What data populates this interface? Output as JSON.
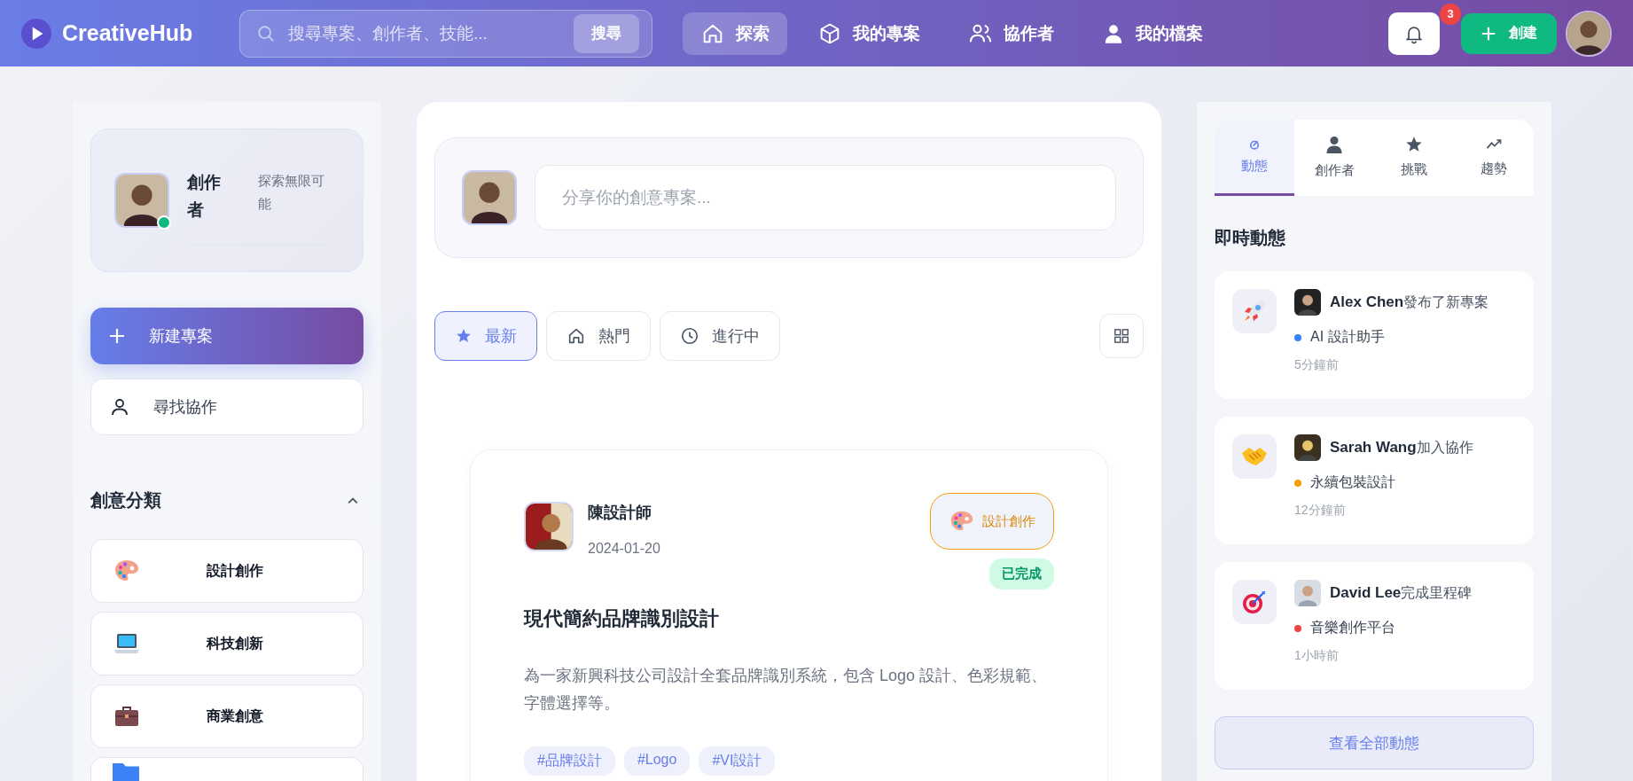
{
  "header": {
    "logo_text": "CreativeHub",
    "search": {
      "placeholder": "搜尋專案、創作者、技能...",
      "button": "搜尋"
    },
    "nav": [
      {
        "label": "探索",
        "kind": "home",
        "selected": true
      },
      {
        "label": "我的專案",
        "kind": "projects",
        "selected": false
      },
      {
        "label": "協作者",
        "kind": "collaborators",
        "selected": false
      },
      {
        "label": "我的檔案",
        "kind": "profile",
        "selected": false
      }
    ],
    "notifications": {
      "count": "3"
    },
    "create_button": "創建"
  },
  "sidebar": {
    "profile": {
      "name": "創作者",
      "tagline": "探索無限可能",
      "online": true
    },
    "actions": [
      {
        "label": "新建專案",
        "kind": "primary"
      },
      {
        "label": "尋找協作",
        "kind": "secondary"
      }
    ],
    "categories": {
      "title": "創意分類",
      "expanded": true,
      "items": [
        {
          "kind": "design",
          "label": "設計創作"
        },
        {
          "kind": "tech",
          "label": "科技創新"
        },
        {
          "kind": "business",
          "label": "商業創意"
        },
        {
          "kind": "other"
        }
      ]
    }
  },
  "feed": {
    "composer": {
      "placeholder": "分享你的創意專案..."
    },
    "filters": [
      {
        "label": "最新",
        "kind": "latest",
        "selected": true
      },
      {
        "label": "熱門",
        "kind": "popular",
        "selected": false
      },
      {
        "label": "進行中",
        "kind": "ongoing",
        "selected": false
      }
    ],
    "posts": [
      {
        "author": "陳設計師",
        "date": "2024-01-20",
        "category": {
          "kind": "design",
          "label": "設計創作"
        },
        "status": "已完成",
        "title": "現代簡約品牌識別設計",
        "description": "為一家新興科技公司設計全套品牌識別系統，包含 Logo 設計、色彩規範、字體選擇等。",
        "tags": [
          "#品牌設計",
          "#Logo",
          "#VI設計"
        ]
      }
    ]
  },
  "activity_panel": {
    "tabs": [
      {
        "label": "動態",
        "kind": "activity",
        "selected": true
      },
      {
        "label": "創作者",
        "kind": "creators",
        "selected": false
      },
      {
        "label": "挑戰",
        "kind": "challenges",
        "selected": false
      },
      {
        "label": "趨勢",
        "kind": "trends",
        "selected": false
      }
    ],
    "title": "即時動態",
    "activities": [
      {
        "kind": "launch",
        "user": "Alex Chen",
        "action": "發布了新專案",
        "project": "AI 設計助手",
        "color": "#3b82f6",
        "time": "5分鐘前"
      },
      {
        "kind": "join",
        "user": "Sarah Wang",
        "action": "加入協作",
        "project": "永續包裝設計",
        "color": "#f59e0b",
        "time": "12分鐘前"
      },
      {
        "kind": "milestone",
        "user": "David Lee",
        "action": "完成里程碑",
        "project": "音樂創作平台",
        "color": "#ef4444",
        "time": "1小時前"
      }
    ],
    "view_all": "查看全部動態"
  }
}
